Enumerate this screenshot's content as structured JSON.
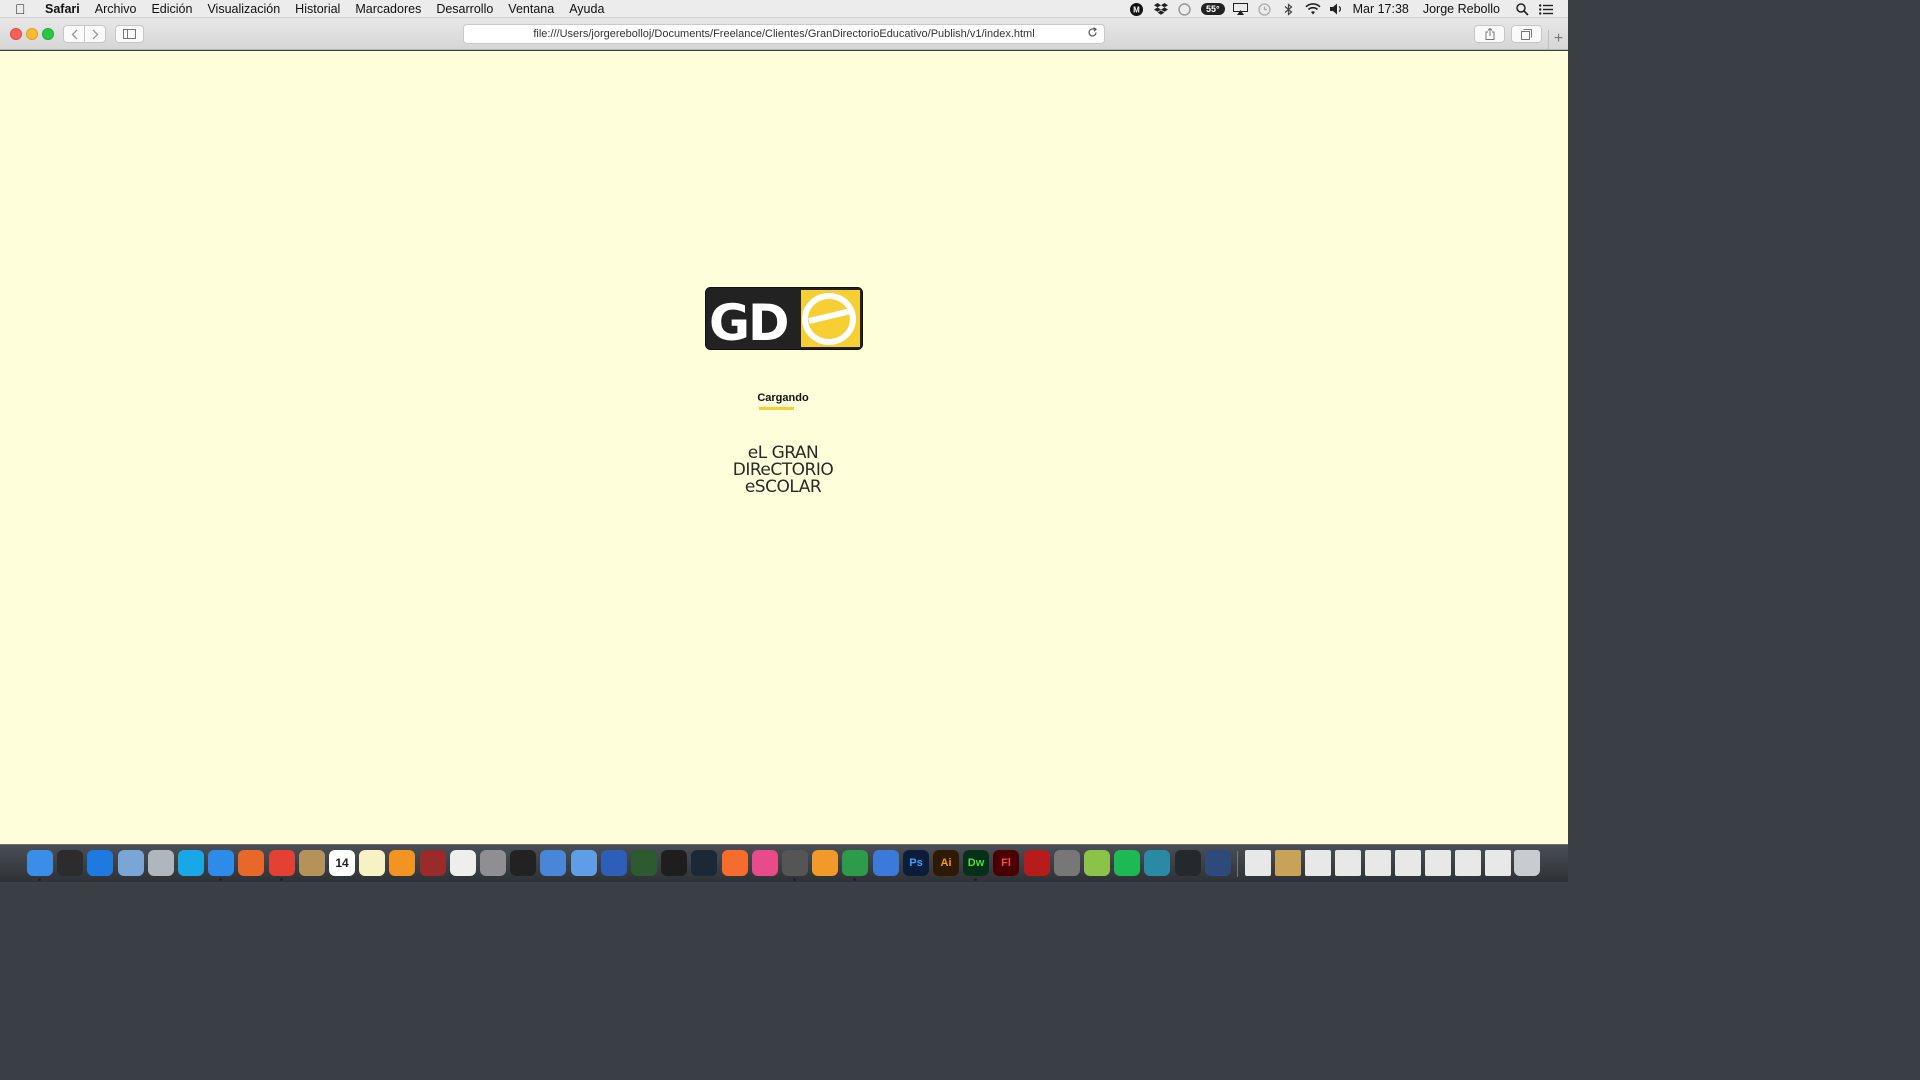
{
  "menubar": {
    "app_name": "Safari",
    "items": [
      "Archivo",
      "Edición",
      "Visualización",
      "Historial",
      "Marcadores",
      "Desarrollo",
      "Ventana",
      "Ayuda"
    ],
    "temperature_badge": "55°",
    "clock": "Mar 17:38",
    "user": "Jorge Rebollo"
  },
  "browser": {
    "url": "file:///Users/jorgerebolloj/Documents/Freelance/Clientes/GranDirectorioEducativo/Publish/v1/index.html"
  },
  "page": {
    "background_color": "#fffedb",
    "logo_letters": "GDe",
    "loading_label": "Cargando",
    "accent_color": "#f5cf33",
    "brand_lines": [
      "eL GRAN",
      "DIReCTORIO",
      "eSCOLAR"
    ]
  },
  "dock": {
    "apps": [
      "finder-icon",
      "dashboard-icon",
      "app-store-icon",
      "preview-icon",
      "launchpad-icon",
      "skype-icon",
      "safari-icon",
      "firefox-icon",
      "chrome-icon",
      "contacts-icon",
      "calendar-icon",
      "notes-icon",
      "ibooks-icon",
      "photo-booth-icon",
      "textedit-icon",
      "system-preferences-icon",
      "terminal-icon",
      "xcode-icon",
      "xcode-tools-icon",
      "simulator-icon",
      "google-earth-icon",
      "terminal2-icon",
      "steam-icon",
      "origin-icon",
      "itunes-icon",
      "sublime-icon",
      "pages-icon",
      "numbers-icon",
      "keynote-icon",
      "photoshop-icon",
      "illustrator-icon",
      "dreamweaver-icon",
      "flash-icon",
      "filezilla-icon",
      "printer-icon",
      "android-icon",
      "spotify-icon",
      "sourcetree-icon",
      "github-icon",
      "tree-icon"
    ],
    "calendar_day": "14",
    "labels": {
      "photoshop": "Ps",
      "illustrator": "Ai",
      "dreamweaver": "Dw",
      "flash": "Fl"
    }
  }
}
